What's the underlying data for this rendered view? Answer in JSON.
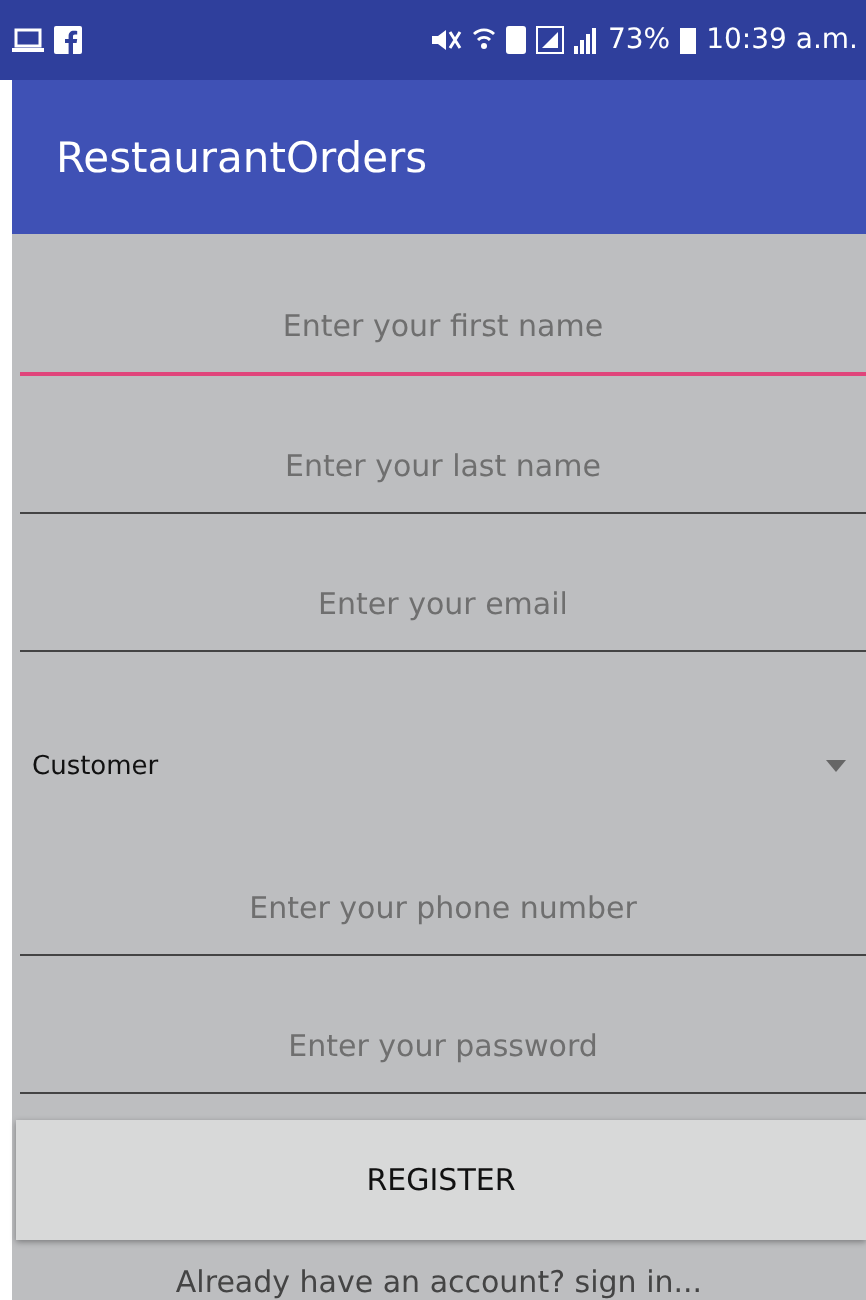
{
  "status_bar": {
    "battery": "73%",
    "time": "10:39 a.m."
  },
  "app_bar": {
    "title": "RestaurantOrders"
  },
  "fields_top": [
    {
      "placeholder": "Enter your first name",
      "focused": true
    },
    {
      "placeholder": "Enter your last name",
      "focused": false
    },
    {
      "placeholder": "Enter your email",
      "focused": false
    }
  ],
  "spinner": {
    "value": "Customer"
  },
  "fields_bottom": [
    {
      "placeholder": "Enter your phone number",
      "focused": false
    },
    {
      "placeholder": "Enter your password",
      "focused": false
    }
  ],
  "button": {
    "label": "REGISTER"
  },
  "link": {
    "text": "Already have an account? sign in..."
  }
}
